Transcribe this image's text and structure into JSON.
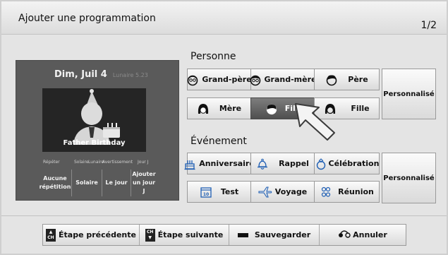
{
  "header": {
    "title": "Ajouter une programmation",
    "page_indicator": "1/2"
  },
  "preview": {
    "date": "Dim, Juil 4",
    "lunar": "Lunaire 5.23",
    "photo_label": "Father Birthday",
    "option_labels": [
      "Répéter",
      "Solaire",
      "Lunaire",
      "Avertissement",
      "Jour J"
    ],
    "options": [
      "Aucune répétition",
      "Solaire",
      "Le jour",
      "Ajouter un jour J"
    ]
  },
  "person": {
    "heading": "Personne",
    "buttons": [
      "Grand-père",
      "Grand-mère",
      "Père",
      "Mère",
      "Fils",
      "Fille"
    ],
    "selected": "Fils",
    "custom": "Personnalisé"
  },
  "event": {
    "heading": "Événement",
    "buttons": [
      "Anniversaire",
      "Rappel",
      "Célébration",
      "Test",
      "Voyage",
      "Réunion"
    ],
    "custom": "Personnalisé"
  },
  "footer": {
    "prev": "Étape précédente",
    "next": "Étape suivante",
    "save": "Sauvegarder",
    "cancel": "Annuler",
    "ch_key": "CH"
  },
  "icons": {
    "grand_father": "grandfather-face-icon",
    "grand_mother": "grandmother-face-icon",
    "father": "father-face-icon",
    "mother": "mother-face-icon",
    "son": "son-face-icon",
    "daughter": "daughter-face-icon",
    "anniversary": "cake-icon",
    "reminder": "bell-icon",
    "celebration": "ring-icon",
    "test": "calendar-icon",
    "travel": "plane-icon",
    "meeting": "people-icon",
    "save": "red-key-icon",
    "cancel": "back-icon"
  }
}
